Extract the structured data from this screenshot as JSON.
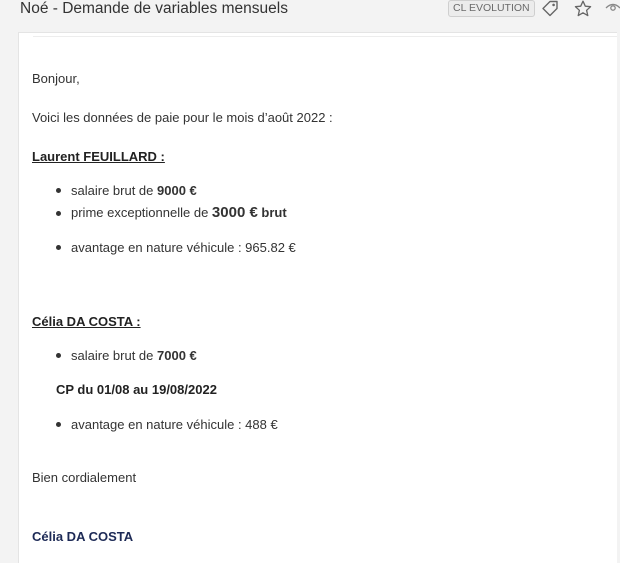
{
  "header": {
    "subject": "Noé - Demande de variables mensuels",
    "tag_label": "CL EVOLUTION",
    "icons": [
      "tag-icon",
      "star-icon",
      "eye-icon"
    ]
  },
  "email": {
    "greeting": "Bonjour,",
    "intro": "Voici les données de paie pour le mois d’août 2022 :",
    "employees": [
      {
        "name": "Laurent FEUILLARD :",
        "items": [
          {
            "prefix": "salaire brut de ",
            "value": "9000 €"
          },
          {
            "prefix": "prime exceptionnelle de ",
            "value": "3000 €",
            "suffix": " brut"
          },
          {
            "text": "avantage en nature véhicule : 965.82 €"
          }
        ]
      },
      {
        "name": "Célia DA COSTA :",
        "items": [
          {
            "prefix": "salaire brut de ",
            "value": "7000  €"
          },
          {
            "text": "avantage en nature véhicule : 488 €"
          }
        ],
        "note": "CP du 01/08 au 19/08/2022"
      }
    ],
    "closing": "Bien cordialement",
    "signature": "Célia DA COSTA"
  }
}
